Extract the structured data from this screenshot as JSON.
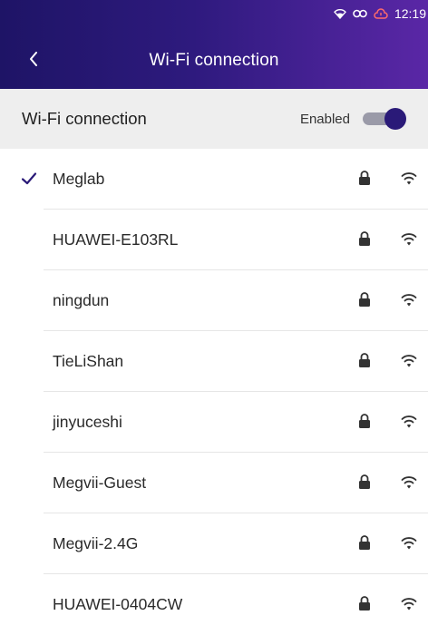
{
  "status_bar": {
    "time": "12:19",
    "icons": [
      "wifi-signal-icon",
      "link-icon",
      "cloud-alert-icon"
    ],
    "alert_color": "#ff6b6b"
  },
  "header": {
    "title": "Wi-Fi connection",
    "back_icon": "chevron-left-icon",
    "gradient": [
      "#1e1466",
      "#5a27a6"
    ]
  },
  "wifi_toggle": {
    "label": "Wi-Fi connection",
    "state_text": "Enabled",
    "enabled": true,
    "accent": "#2a1a78"
  },
  "networks": [
    {
      "ssid": "Meglab",
      "connected": true,
      "secured": true
    },
    {
      "ssid": "HUAWEI-E103RL",
      "connected": false,
      "secured": true
    },
    {
      "ssid": "ningdun",
      "connected": false,
      "secured": true
    },
    {
      "ssid": "TieLiShan",
      "connected": false,
      "secured": true
    },
    {
      "ssid": "jinyuceshi",
      "connected": false,
      "secured": true
    },
    {
      "ssid": "Megvii-Guest",
      "connected": false,
      "secured": true
    },
    {
      "ssid": "Megvii-2.4G",
      "connected": false,
      "secured": true
    },
    {
      "ssid": "HUAWEI-0404CW",
      "connected": false,
      "secured": true
    }
  ]
}
